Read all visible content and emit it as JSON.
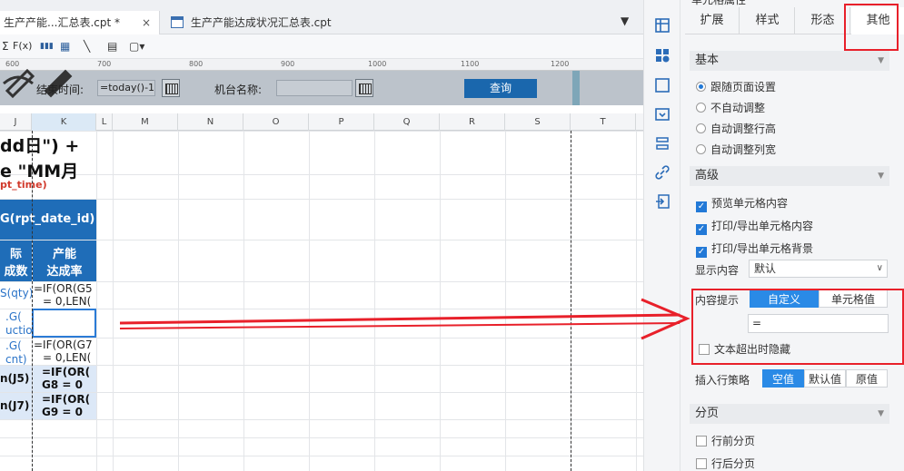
{
  "tabs": {
    "active": {
      "label": "生产产能...汇总表.cpt *",
      "close": "×"
    },
    "inactive": {
      "label": "生产产能达成状况汇总表.cpt"
    },
    "menu_glyph": "▼"
  },
  "toolbar": {
    "items": [
      "Σ",
      "F(x)",
      "▮▮▮",
      "▦",
      "╲",
      "▤",
      "▢▾"
    ]
  },
  "ruler": {
    "marks": [
      "600",
      "700",
      "800",
      "900",
      "1000",
      "1100",
      "1200"
    ]
  },
  "params": {
    "end_time_label": "结束时间:",
    "end_time_value": "=today()-1",
    "machine_label": "机台名称:",
    "query_label": "查询"
  },
  "columns": [
    "J",
    "K",
    "L",
    "M",
    "N",
    "O",
    "P",
    "Q",
    "R",
    "S",
    "T"
  ],
  "cells": {
    "row1": "dd日\") +",
    "row2": "e \"MM月",
    "rpt_time": "pt_time)",
    "rpt_date": "G(rpt_date_id)",
    "hdr_j1": "际",
    "hdr_j2": "成数",
    "hdr_k1": "产能",
    "hdr_k2": "达成率",
    "j5": "S(qty)",
    "k5a": "=IF(OR(G5",
    "k5b": "= 0,LEN(",
    "j6a": ".G(",
    "j6b": "uctio",
    "j7a": ".G(",
    "j7b": "cnt)",
    "k7a": "=IF(OR(G7",
    "k7b": "= 0,LEN(",
    "j8": "n(J5)",
    "k8a": "=IF(OR(",
    "k8b": "G8 = 0",
    "j9": "n(J7)",
    "k9a": "=IF(OR(",
    "k9b": "G9 = 0"
  },
  "panel": {
    "header": "单元格属性",
    "tabs": [
      "扩展",
      "样式",
      "形态",
      "其他"
    ],
    "basic": {
      "title": "基本",
      "options": [
        "跟随页面设置",
        "不自动调整",
        "自动调整行高",
        "自动调整列宽"
      ],
      "selected": 0
    },
    "advanced": {
      "title": "高级",
      "checks": [
        "预览单元格内容",
        "打印/导出单元格内容",
        "打印/导出单元格背景"
      ],
      "display_label": "显示内容",
      "display_value": "默认",
      "tooltip_label": "内容提示",
      "tooltip_tabs": [
        "自定义",
        "单元格值"
      ],
      "tooltip_value": "=",
      "hide_overflow": "文本超出时隐藏",
      "insert_label": "插入行策略",
      "insert_options": [
        "空值",
        "默认值",
        "原值"
      ]
    },
    "paging": {
      "title": "分页",
      "checks": [
        "行前分页",
        "行后分页"
      ]
    }
  },
  "colors": {
    "accent": "#2a8ae6",
    "header_blue": "#1f6db8",
    "annotation_red": "#e8202a",
    "param_bar": "#bcc3cb"
  }
}
